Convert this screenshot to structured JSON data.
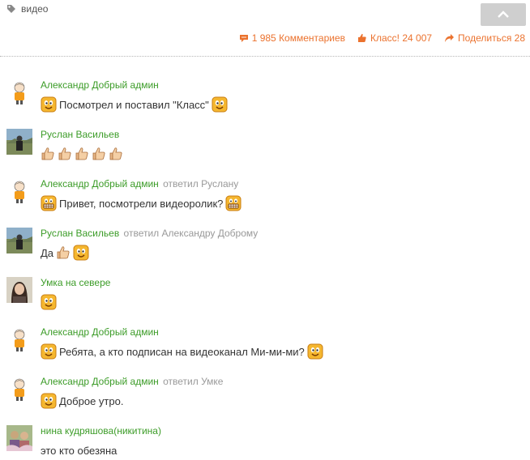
{
  "tags": {
    "label": "видео"
  },
  "actions": {
    "comments": "1 985 Комментариев",
    "likes": "Класс! 24 007",
    "share": "Поделиться 28"
  },
  "comments": [
    {
      "author": "Александр Добрый админ",
      "reply_to": "",
      "text": "Посмотрел и поставил \"Класс\""
    },
    {
      "author": "Руслан Васильев",
      "reply_to": "",
      "text": ""
    },
    {
      "author": "Александр Добрый админ",
      "reply_to": "ответил Руслану",
      "text": "Привет, посмотрели видеоролик?"
    },
    {
      "author": "Руслан Васильев",
      "reply_to": "ответил Александру Доброму",
      "text": "Да"
    },
    {
      "author": "Умка на севере",
      "reply_to": "",
      "text": ""
    },
    {
      "author": "Александр Добрый админ",
      "reply_to": "",
      "text": "Ребята, а кто подписан на видеоканал Ми-ми-ми?"
    },
    {
      "author": "Александр Добрый админ",
      "reply_to": "ответил Умке",
      "text": "Доброе утро."
    },
    {
      "author": "нина кудряшова(никитина)",
      "reply_to": "",
      "text": "это кто обезяна"
    }
  ],
  "colors": {
    "author": "#3c9c28",
    "accent": "#eb722e",
    "muted": "#999999"
  }
}
